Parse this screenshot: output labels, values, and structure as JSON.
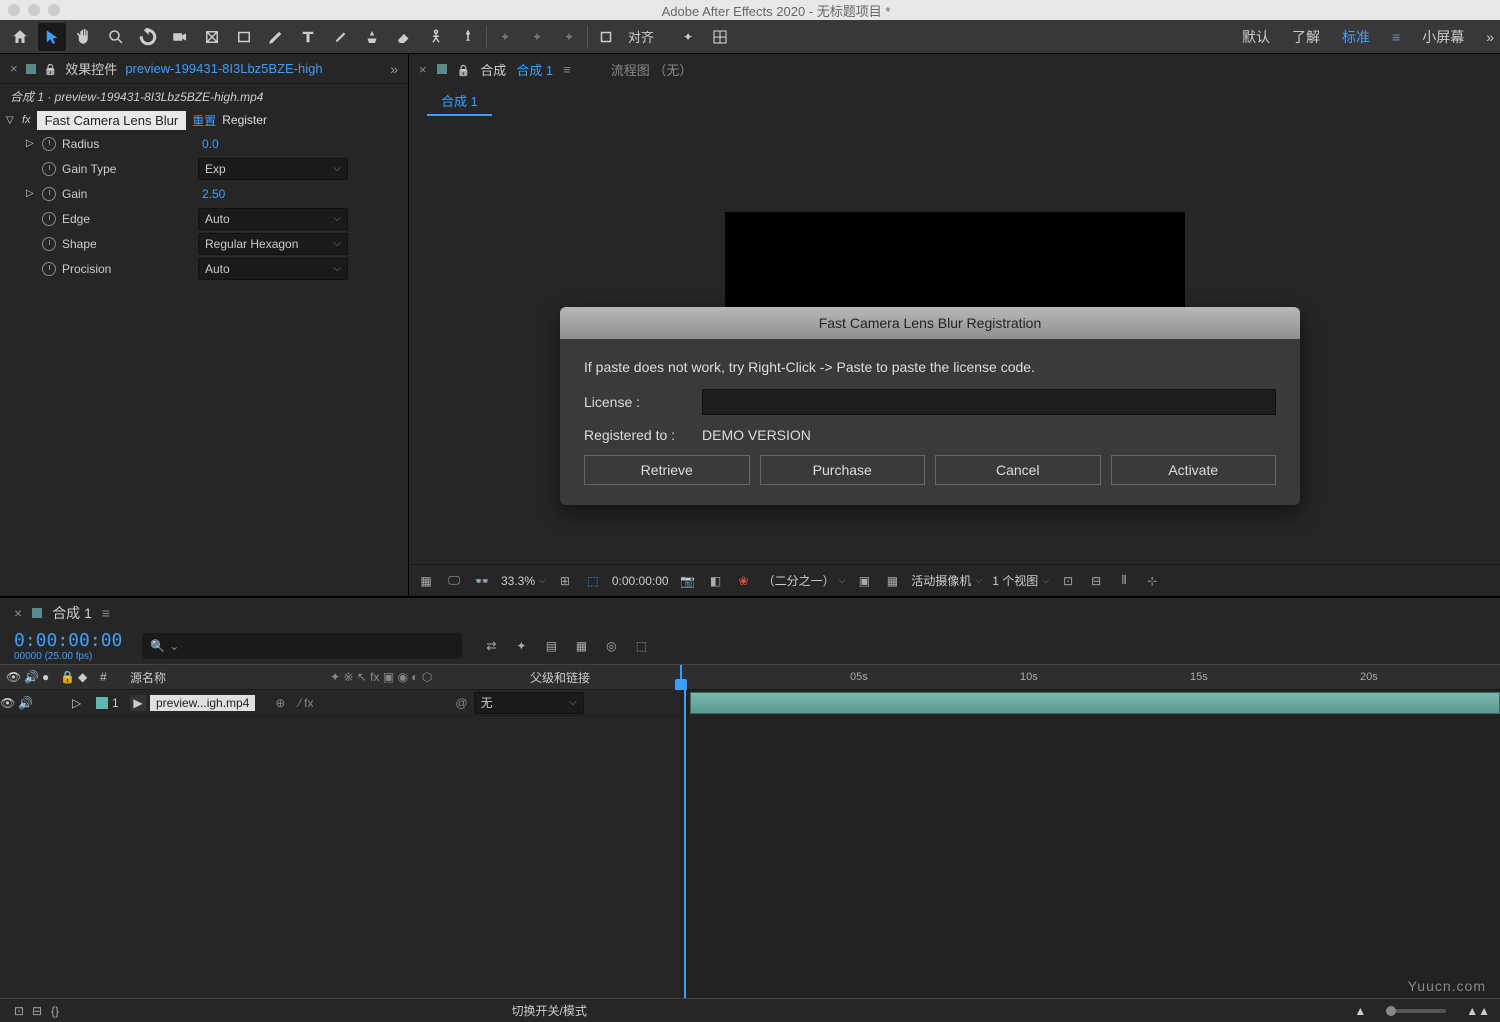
{
  "app": {
    "title": "Adobe After Effects 2020 - 无标题项目 *"
  },
  "toolbar": {
    "align": "对齐",
    "workspaces": {
      "default": "默认",
      "learn": "了解",
      "standard": "标准",
      "small": "小屏幕"
    }
  },
  "effects_panel": {
    "tab_label": "效果控件",
    "filename": "preview-199431-8I3Lbz5BZE-high",
    "breadcrumb": "合成 1 · preview-199431-8I3Lbz5BZE-high.mp4",
    "framecount": "00000 (25.00 fps)",
    "effect_name": "Fast Camera Lens Blur",
    "reset": "重置",
    "register": "Register",
    "props": {
      "radius": {
        "label": "Radius",
        "value": "0.0"
      },
      "gain_type": {
        "label": "Gain Type",
        "value": "Exp"
      },
      "gain": {
        "label": "Gain",
        "value": "2.50"
      },
      "edge": {
        "label": "Edge",
        "value": "Auto"
      },
      "shape": {
        "label": "Shape",
        "value": "Regular Hexagon"
      },
      "procision": {
        "label": "Procision",
        "value": "Auto"
      }
    }
  },
  "comp_panel": {
    "label": "合成",
    "active": "合成 1",
    "flowchart": "流程图",
    "none": "（无）",
    "sub_tab": "合成 1"
  },
  "viewer": {
    "zoom": "33.3%",
    "time": "0:00:00:00",
    "resolution": "（二分之一）",
    "camera": "活动摄像机",
    "views": "1 个视图"
  },
  "timeline": {
    "tab": "合成 1",
    "timecode": "0:00:00:00",
    "fps": "00000 (25.00 fps)",
    "col_num": "#",
    "col_source": "源名称",
    "col_parent": "父级和链接",
    "layer": {
      "index": "1",
      "name": "preview...igh.mp4",
      "parent": "无"
    },
    "ticks": [
      "05s",
      "10s",
      "15s",
      "20s"
    ],
    "footer_toggle": "切换开关/模式"
  },
  "dialog": {
    "title": "Fast Camera Lens Blur Registration",
    "hint": "If paste does not work, try Right-Click -> Paste to paste the license code.",
    "license_label": "License :",
    "registered_label": "Registered to :",
    "registered_value": "DEMO VERSION",
    "btn_retrieve": "Retrieve",
    "btn_purchase": "Purchase",
    "btn_cancel": "Cancel",
    "btn_activate": "Activate"
  },
  "watermark": "Yuucn.com"
}
